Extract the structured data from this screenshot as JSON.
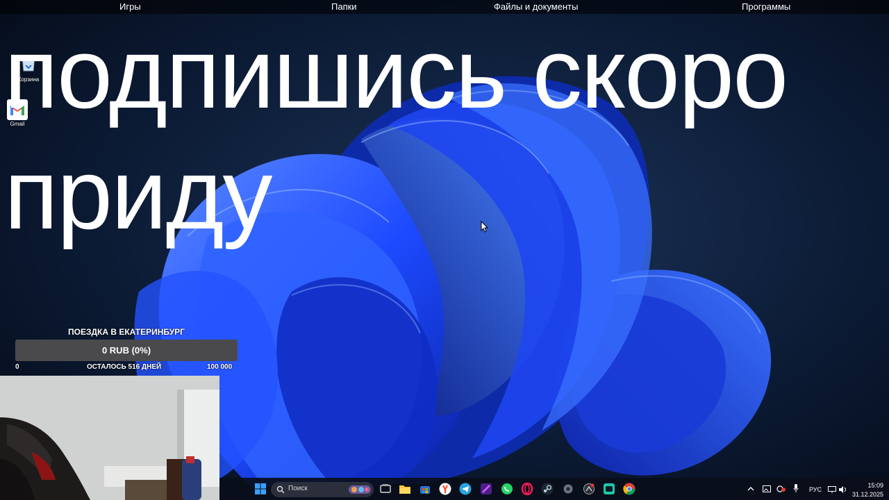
{
  "fences": [
    "Игры",
    "Папки",
    "Файлы и документы",
    "Программы"
  ],
  "desktop_icons": [
    {
      "label": "Корзина",
      "icon": "recycle-bin-icon"
    },
    {
      "label": "Gmail",
      "icon": "gmail-icon"
    }
  ],
  "overlay": {
    "line1": "подпишись скоро",
    "line2": "приду"
  },
  "goal": {
    "title": "ПОЕЗДКА В ЕКАТЕРИНБУРГ",
    "amount": "0 RUB (0%)",
    "progress_fraction": 0,
    "min": "0",
    "remaining": "ОСТАЛОСЬ 516 ДНЕЙ",
    "max": "100 000"
  },
  "taskbar": {
    "search_placeholder": "Поиск",
    "pinned": [
      "start-icon",
      "search-icon",
      "task-view-icon",
      "file-explorer-icon",
      "store-icon",
      "yandex-icon",
      "telegram-icon",
      "app-icon",
      "whatsapp-icon",
      "opera-gx-icon",
      "steam-icon",
      "settings-icon",
      "app-icon",
      "app-icon",
      "chrome-icon"
    ],
    "tray": {
      "language": "РУС",
      "time": "15:09",
      "date": "31.12.2025"
    }
  },
  "colors": {
    "wallpaper_bg": "#07101f",
    "bloom_blue": "#1f4fff",
    "goal_bar": "#4a4a4d"
  }
}
